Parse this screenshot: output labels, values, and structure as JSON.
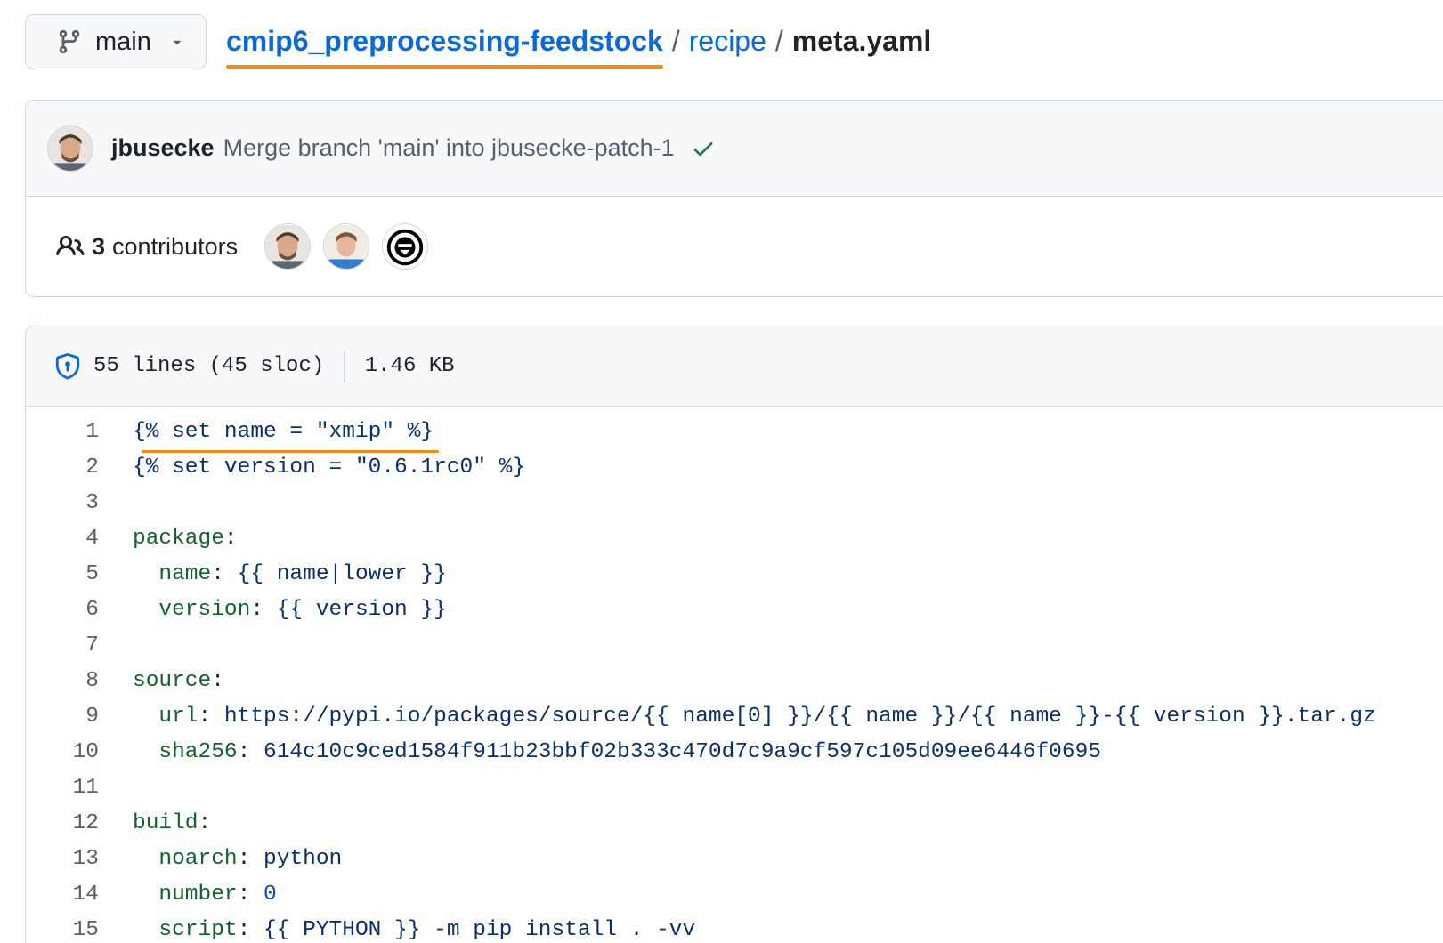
{
  "branch": {
    "label": "main"
  },
  "breadcrumb": {
    "repo": "cmip6_preprocessing-feedstock",
    "sep1": "/",
    "folder": "recipe",
    "sep2": "/",
    "file": "meta.yaml"
  },
  "commit": {
    "author": "jbusecke",
    "message": "Merge branch 'main' into jbusecke-patch-1"
  },
  "contributors": {
    "count": "3",
    "label": "contributors"
  },
  "file_info": {
    "lines": "55 lines (45 sloc)",
    "size": "1.46 KB"
  },
  "code_lines": [
    {
      "num": "1"
    },
    {
      "num": "2"
    },
    {
      "num": "3"
    },
    {
      "num": "4"
    },
    {
      "num": "5"
    },
    {
      "num": "6"
    },
    {
      "num": "7"
    },
    {
      "num": "8"
    },
    {
      "num": "9"
    },
    {
      "num": "10"
    },
    {
      "num": "11"
    },
    {
      "num": "12"
    },
    {
      "num": "13"
    },
    {
      "num": "14"
    },
    {
      "num": "15"
    }
  ],
  "code": {
    "l1": "{% set name = \"xmip\" %}",
    "l2": "{% set version = \"0.6.1rc0\" %}",
    "l4_key": "package",
    "l5_key": "name",
    "l5_val": "{{ name|lower }}",
    "l6_key": "version",
    "l6_val": "{{ version }}",
    "l8_key": "source",
    "l9_key": "url",
    "l9_val": "https://pypi.io/packages/source/{{ name[0] }}/{{ name }}/{{ name }}-{{ version }}.tar.gz",
    "l10_key": "sha256",
    "l10_val": "614c10c9ced1584f911b23bbf02b333c470d7c9a9cf597c105d09ee6446f0695",
    "l12_key": "build",
    "l13_key": "noarch",
    "l13_val": "python",
    "l14_key": "number",
    "l14_val": "0",
    "l15_key": "script",
    "l15_val": "{{ PYTHON }} -m pip install . -vv"
  },
  "icons": {
    "branch": "git-branch-icon",
    "caret": "triangle-down-icon",
    "check": "check-icon",
    "people": "people-icon",
    "shield": "shield-icon"
  },
  "colors": {
    "link": "#0969da",
    "highlight": "#f28c17",
    "check": "#1a7f37",
    "yaml_key": "#116329",
    "string": "#0a3069"
  }
}
